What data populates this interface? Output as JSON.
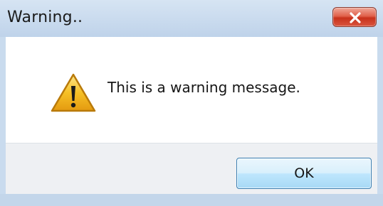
{
  "dialog": {
    "title": "Warning..",
    "message": "This is a warning message.",
    "ok_label": "OK"
  },
  "icons": {
    "close": "close-icon",
    "warning": "warning-icon"
  },
  "colors": {
    "title_bar": "#c9dbee",
    "close_button": "#d9553e",
    "warning_yellow": "#f6c026",
    "ok_button": "#bee6fd"
  }
}
